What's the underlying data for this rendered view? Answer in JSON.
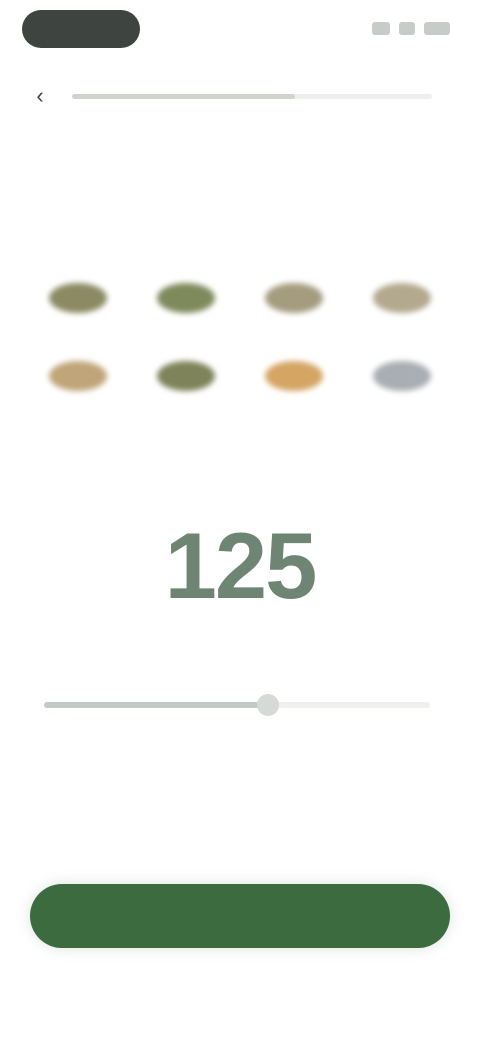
{
  "status_bar": {
    "time": "",
    "icons": [
      "signal-icon",
      "wifi-icon",
      "battery-icon"
    ]
  },
  "nav": {
    "back_icon": "back-arrow-icon",
    "progress_percent": 62
  },
  "question": {
    "title": ""
  },
  "food_grid": {
    "items": [
      {
        "color": "#8c8a63"
      },
      {
        "color": "#7f8a5c"
      },
      {
        "color": "#a59c80"
      },
      {
        "color": "#b3a98f"
      },
      {
        "color": "#c0a57a"
      },
      {
        "color": "#7e835a"
      },
      {
        "color": "#d5a564"
      },
      {
        "color": "#a9aeb4"
      }
    ],
    "labels": []
  },
  "value": {
    "number": "125",
    "unit": ""
  },
  "slider": {
    "level_percent": 58,
    "min_label": "",
    "max_label": ""
  },
  "button": {
    "label": ""
  },
  "colors": {
    "accent": "#3c6b40",
    "value_text": "#55705b"
  }
}
